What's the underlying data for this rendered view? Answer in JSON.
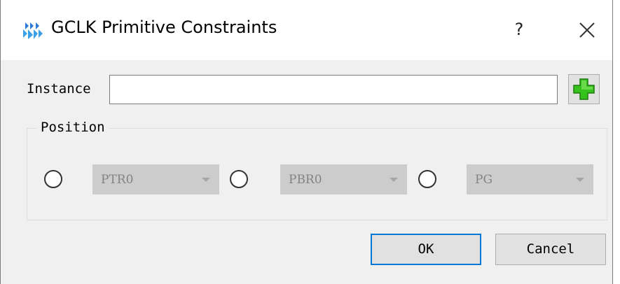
{
  "window": {
    "title": "GCLK Primitive Constraints",
    "icon": "gowin-logo-icon",
    "help_label": "?",
    "close_icon": "close-icon"
  },
  "instance": {
    "label": "Instance",
    "value": "",
    "add_icon": "plus-icon",
    "add_icon_color": "#36c21c"
  },
  "position": {
    "title": "Position",
    "options": [
      {
        "selected": false,
        "value": "PTR0",
        "enabled": false
      },
      {
        "selected": false,
        "value": "PBR0",
        "enabled": false
      },
      {
        "selected": false,
        "value": "PG",
        "enabled": false
      }
    ]
  },
  "buttons": {
    "ok_label": "OK",
    "cancel_label": "Cancel"
  },
  "colors": {
    "accent": "#0078d7",
    "dialog_background": "#f0f0f0",
    "disabled_combo": "#cccccc"
  }
}
